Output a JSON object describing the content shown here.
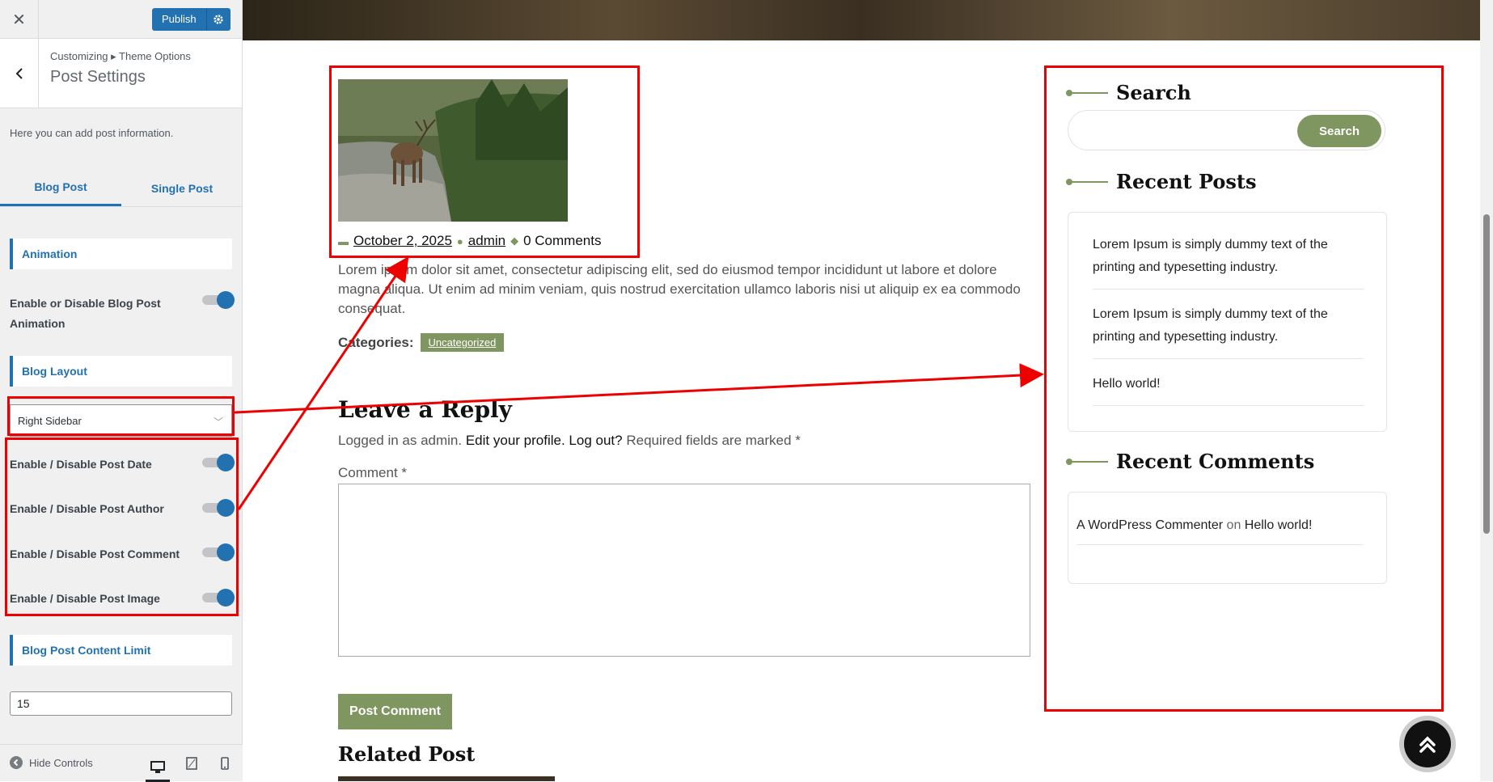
{
  "customizer": {
    "close_icon": "close-icon",
    "publish_label": "Publish",
    "breadcrumb": "Customizing ▸ Theme Options",
    "section_title": "Post Settings",
    "description": "Here you can add post information.",
    "tabs": [
      {
        "label": "Blog Post",
        "active": true
      },
      {
        "label": "Single Post",
        "active": false
      }
    ],
    "animation_heading": "Animation",
    "animation_toggle_label": "Enable or Disable Blog Post Animation",
    "layout_heading": "Blog Layout",
    "layout_value": "Right Sidebar",
    "toggles": [
      {
        "label": "Enable / Disable Post Date",
        "on": true
      },
      {
        "label": "Enable / Disable Post Author",
        "on": true
      },
      {
        "label": "Enable / Disable Post Comment",
        "on": true
      },
      {
        "label": "Enable / Disable Post Image",
        "on": true
      }
    ],
    "content_limit_heading": "Blog Post Content Limit",
    "content_limit_value": "15",
    "hide_controls_label": "Hide Controls",
    "accent_color": "#2271b1"
  },
  "post": {
    "date": "October 2, 2025",
    "author": "admin",
    "comments": "0 Comments",
    "excerpt": "Lorem ipsum dolor sit amet, consectetur adipiscing elit, sed do eiusmod tempor incididunt ut labore et dolore magna aliqua. Ut enim ad minim veniam, quis nostrud exercitation ullamco laboris nisi ut aliquip ex ea commodo consequat.",
    "categories_label": "Categories:",
    "category": "Uncategorized",
    "accent_color": "#7f9660"
  },
  "reply": {
    "title": "Leave a Reply",
    "logged_in_prefix": "Logged in as admin.",
    "edit_profile": "Edit your profile.",
    "log_out": "Log out?",
    "required_note": "Required fields are marked",
    "required_star": "*",
    "comment_label": "Comment *",
    "submit_label": "Post Comment"
  },
  "related_title": "Related Post",
  "sidebar": {
    "search_title": "Search",
    "search_button": "Search",
    "recent_posts_title": "Recent Posts",
    "recent_posts": [
      "Lorem Ipsum is simply dummy text of the printing and typesetting industry.",
      "Lorem Ipsum is simply dummy text of the printing and typesetting industry.",
      "Hello world!"
    ],
    "recent_comments_title": "Recent Comments",
    "comment_author": "A WordPress Commenter",
    "comment_on": "on",
    "comment_post": "Hello world!"
  }
}
